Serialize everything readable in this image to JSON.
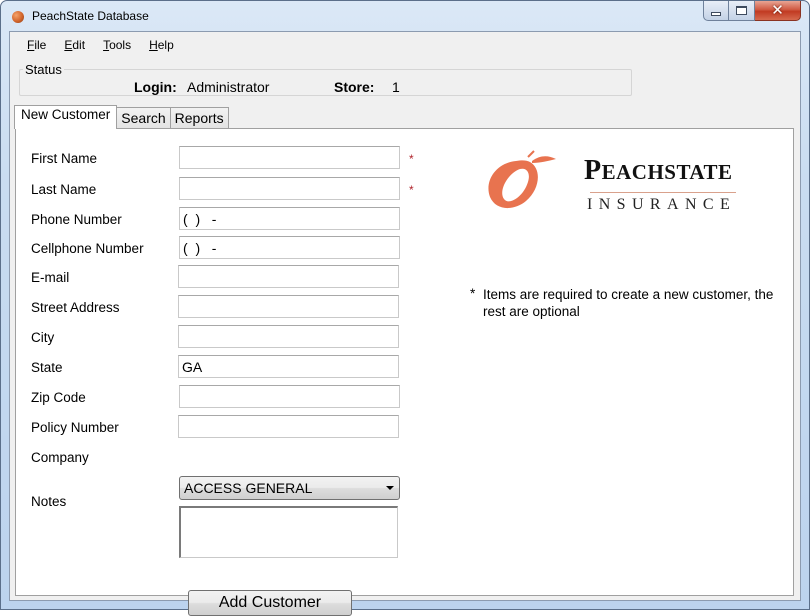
{
  "window": {
    "title": "PeachState Database",
    "icon": "peach-app-icon",
    "controls": {
      "minimize": "minimize-icon",
      "maximize": "maximize-icon",
      "close": "close-icon"
    }
  },
  "menu": [
    {
      "label": "File",
      "mnemonic": "F"
    },
    {
      "label": "Edit",
      "mnemonic": "E"
    },
    {
      "label": "Tools",
      "mnemonic": "T"
    },
    {
      "label": "Help",
      "mnemonic": "H"
    }
  ],
  "status": {
    "group_label": "Status",
    "login_label": "Login:",
    "login_value": "Administrator",
    "store_label": "Store:",
    "store_value": "1"
  },
  "tabs": [
    {
      "label": "New Customer",
      "active": true
    },
    {
      "label": "Search",
      "active": false
    },
    {
      "label": "Reports",
      "active": false
    }
  ],
  "form": {
    "fields": [
      {
        "label": "First Name",
        "value": "",
        "required": true
      },
      {
        "label": "Last Name",
        "value": "",
        "required": true
      },
      {
        "label": "Phone Number",
        "value": "(  )   -",
        "required": false
      },
      {
        "label": "Cellphone Number",
        "value": "(  )   -",
        "required": false
      },
      {
        "label": "E-mail",
        "value": "",
        "required": false
      },
      {
        "label": "Street Address",
        "value": "",
        "required": false
      },
      {
        "label": "City",
        "value": "",
        "required": false
      },
      {
        "label": "State",
        "value": "GA",
        "required": false
      },
      {
        "label": "Zip Code",
        "value": "",
        "required": false
      },
      {
        "label": "Policy Number",
        "value": "",
        "required": false
      }
    ],
    "required_marker": "*",
    "company_label": "Company",
    "company_value": "ACCESS GENERAL",
    "notes_label": "Notes",
    "notes_value": "",
    "submit_label": "Add Customer"
  },
  "logo": {
    "name_first": "P",
    "name_rest": "EACHSTATE",
    "subtitle": "INSURANCE",
    "colors": {
      "peach": "#E8734F",
      "text": "#111111"
    }
  },
  "note": {
    "marker": "*",
    "text": "Items are required to create a new customer, the rest are optional"
  }
}
